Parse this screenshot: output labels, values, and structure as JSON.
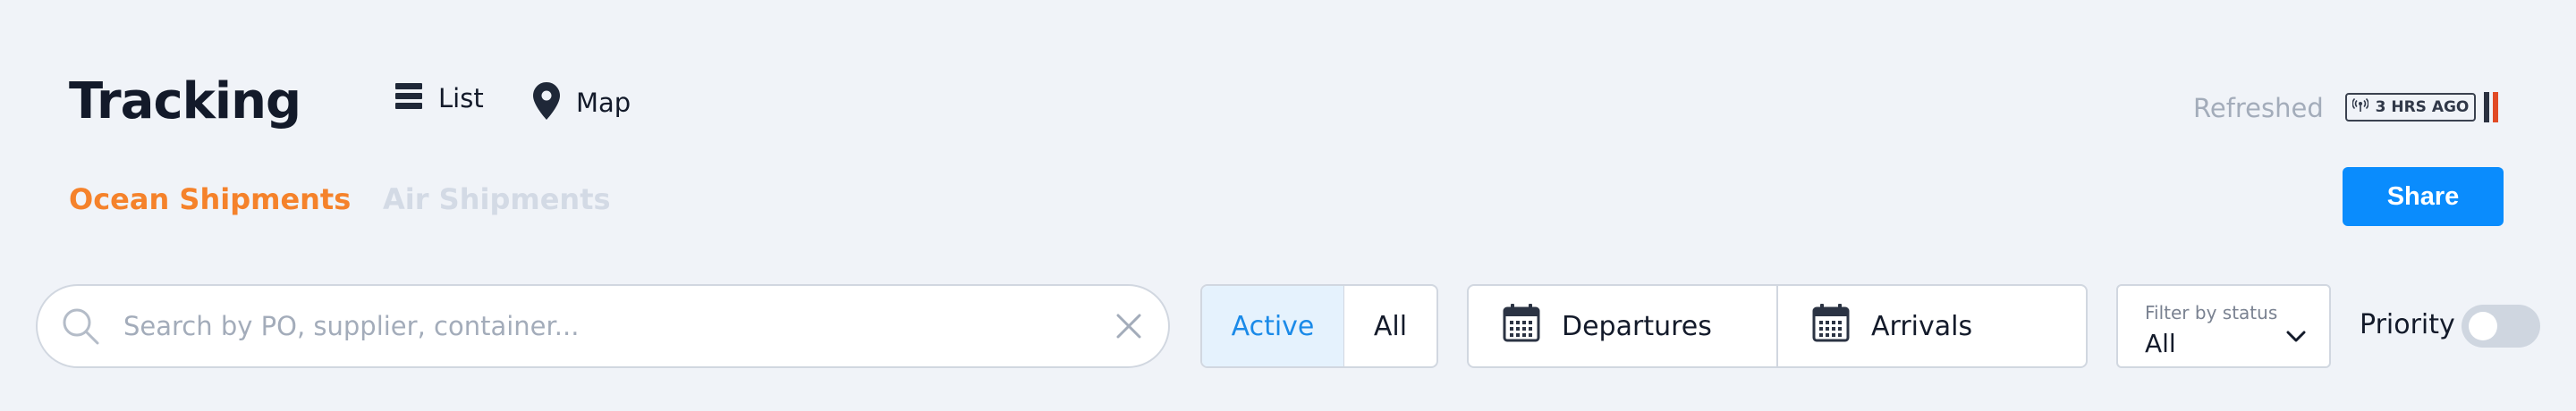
{
  "header": {
    "title": "Tracking",
    "views": [
      {
        "label": "List",
        "icon": "list-icon"
      },
      {
        "label": "Map",
        "icon": "map-pin-icon"
      }
    ],
    "refreshed_label": "Refreshed",
    "refresh_badge": {
      "icon": "signal-icon",
      "text": "3 HRS AGO"
    }
  },
  "tabs": [
    {
      "label": "Ocean Shipments",
      "active": true
    },
    {
      "label": "Air Shipments",
      "active": false
    }
  ],
  "share_label": "Share",
  "filters": {
    "search": {
      "placeholder": "Search by PO, supplier, container...",
      "value": ""
    },
    "activity": {
      "options": [
        "Active",
        "All"
      ],
      "selected": "Active"
    },
    "dates": [
      {
        "label": "Departures",
        "icon": "calendar-icon"
      },
      {
        "label": "Arrivals",
        "icon": "calendar-icon"
      }
    ],
    "status": {
      "label": "Filter by status",
      "value": "All"
    },
    "priority": {
      "label": "Priority",
      "enabled": false
    }
  },
  "colors": {
    "accent_orange": "#f5822b",
    "primary_blue": "#0a8cfd",
    "active_tint": "#e5f2fd",
    "status_red": "#e14a25"
  }
}
